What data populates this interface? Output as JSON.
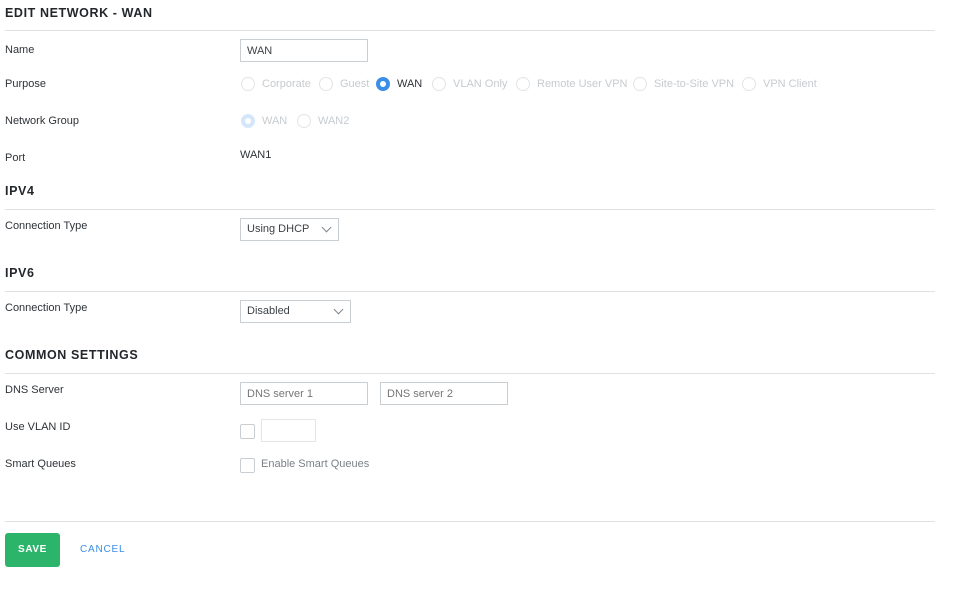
{
  "page_title": "EDIT NETWORK - WAN",
  "fields": {
    "name": {
      "label": "Name",
      "value": "WAN"
    },
    "purpose": {
      "label": "Purpose",
      "options": [
        "Corporate",
        "Guest",
        "WAN",
        "VLAN Only",
        "Remote User VPN",
        "Site-to-Site VPN",
        "VPN Client"
      ],
      "selected": "WAN"
    },
    "network_group": {
      "label": "Network Group",
      "options": [
        "WAN",
        "WAN2"
      ],
      "selected": "WAN"
    },
    "port": {
      "label": "Port",
      "value": "WAN1"
    }
  },
  "ipv4": {
    "title": "IPV4",
    "connection_type": {
      "label": "Connection Type",
      "value": "Using DHCP"
    }
  },
  "ipv6": {
    "title": "IPV6",
    "connection_type": {
      "label": "Connection Type",
      "value": "Disabled"
    }
  },
  "common": {
    "title": "COMMON SETTINGS",
    "dns": {
      "label": "DNS Server",
      "placeholder1": "DNS server 1",
      "placeholder2": "DNS server 2"
    },
    "vlan": {
      "label": "Use VLAN ID",
      "value": ""
    },
    "smart_queues": {
      "label": "Smart Queues",
      "checkbox_label": "Enable Smart Queues"
    }
  },
  "actions": {
    "save": "SAVE",
    "cancel": "CANCEL"
  },
  "colors": {
    "accent": "#3a8ee6",
    "save": "#2cb56a",
    "disabled_text": "#c7cbcf"
  }
}
